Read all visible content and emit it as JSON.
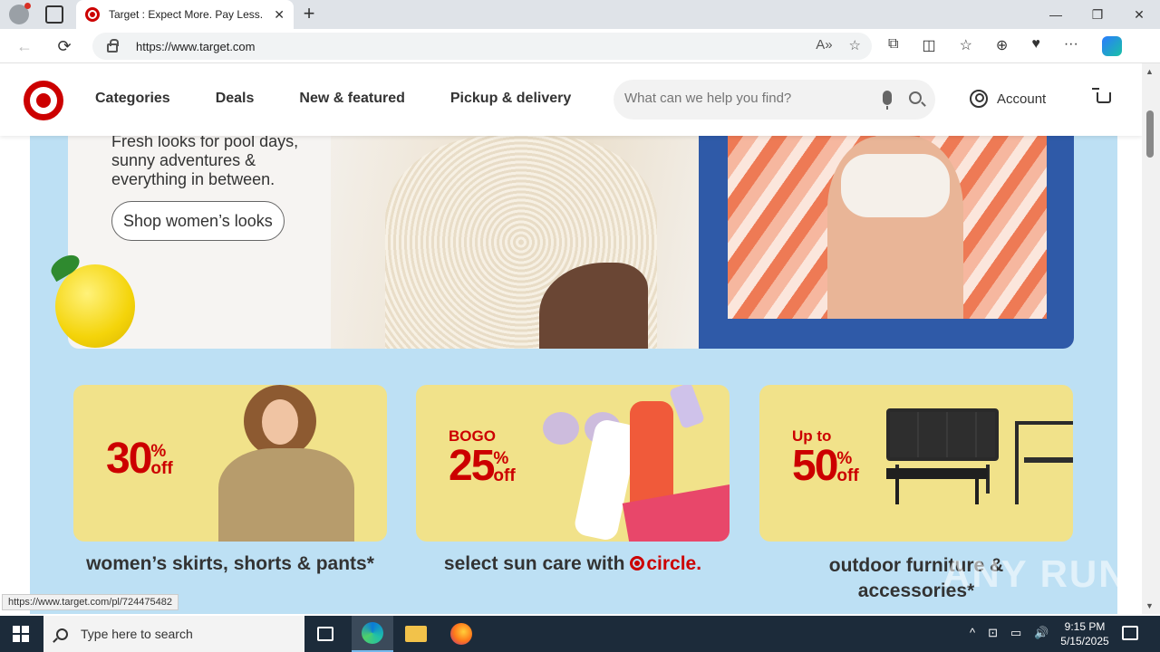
{
  "browser": {
    "tab_title": "Target : Expect More. Pay Less.",
    "url": "https://www.target.com",
    "status_url": "https://www.target.com/pl/724475482",
    "new_tab_symbol": "+",
    "close_symbol": "✕",
    "window_controls": [
      "—",
      "❐",
      "✕"
    ],
    "back_symbol": "←",
    "reload_symbol": "⟳",
    "addr_right_icons": [
      "A»",
      "☆"
    ],
    "toolbar_icons": [
      "⧉",
      "◫",
      "☆",
      "⊕",
      "♥",
      "···"
    ]
  },
  "site": {
    "nav": [
      "Categories",
      "Deals",
      "New & featured",
      "Pickup & delivery"
    ],
    "search_placeholder": "What can we help you find?",
    "account_label": "Account",
    "brand_color": "#cc0000"
  },
  "hero": {
    "text_lines": [
      "Fresh looks for pool days,",
      "sunny adventures &",
      "everything in between."
    ],
    "button_label": "Shop women’s looks"
  },
  "deals": [
    {
      "pre": "",
      "value": "30",
      "suffix_top": "%",
      "suffix_bottom": "off",
      "label": "women’s skirts, shorts & pants*"
    },
    {
      "pre": "BOGO",
      "value": "25",
      "suffix_top": "%",
      "suffix_bottom": "off",
      "label_prefix": "select sun care with",
      "label_brand": "circle",
      "label_end": "."
    },
    {
      "pre": "Up to",
      "value": "50",
      "suffix_top": "%",
      "suffix_bottom": "off",
      "label_line1": "outdoor furniture &",
      "label_line2": "accessories*"
    }
  ],
  "watermark": "ANY RUN",
  "taskbar": {
    "search_placeholder": "Type here to search",
    "time": "9:15 PM",
    "date": "5/15/2025",
    "tray_icons": [
      "^",
      "⊡",
      "▭",
      "🔊"
    ]
  }
}
